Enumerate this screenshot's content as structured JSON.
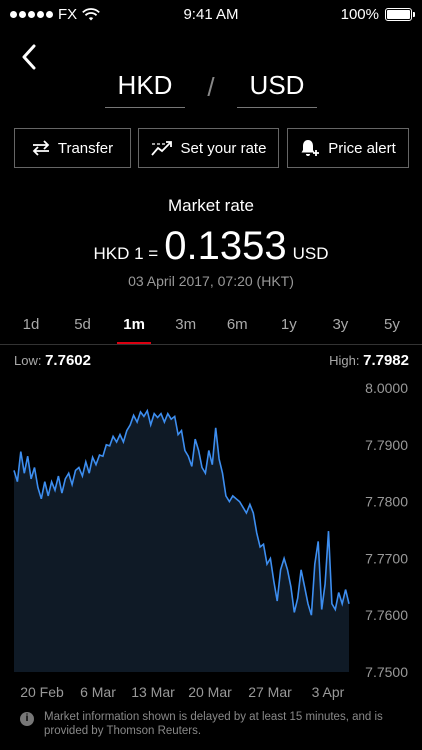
{
  "status_bar": {
    "carrier": "FX",
    "time": "9:41 AM",
    "battery": "100%"
  },
  "pair": {
    "from": "HKD",
    "separator": "/",
    "to": "USD"
  },
  "actions": {
    "transfer": "Transfer",
    "set_rate": "Set your rate",
    "price_alert": "Price alert"
  },
  "market": {
    "label": "Market rate",
    "base": "HKD 1 =",
    "value": "0.1353",
    "quote": "USD",
    "date": "03 April 2017, 07:20 (HKT)"
  },
  "periods": [
    "1d",
    "5d",
    "1m",
    "3m",
    "6m",
    "1y",
    "3y",
    "5y"
  ],
  "active_period": "1m",
  "stats": {
    "low_label": "Low:",
    "low_value": "7.7602",
    "high_label": "High:",
    "high_value": "7.7982"
  },
  "footer": {
    "note": "Market information shown is delayed by at least 15 minutes, and is provided by Thomson Reuters."
  },
  "colors": {
    "accent": "#db0011",
    "line": "#3d8ef0",
    "fill": "#0f1a26"
  },
  "chart_data": {
    "type": "area",
    "ylim": [
      7.75,
      8.0
    ],
    "yticks": [
      "8.0000",
      "7.7900",
      "7.7800",
      "7.7700",
      "7.7600",
      "7.7500"
    ],
    "ytick_values": [
      7.8,
      7.79,
      7.78,
      7.77,
      7.76,
      7.75
    ],
    "xticks": [
      "20 Feb",
      "6 Mar",
      "13 Mar",
      "20 Mar",
      "27 Mar",
      "3 Apr"
    ],
    "values": [
      7.7855,
      7.7835,
      7.7888,
      7.785,
      7.788,
      7.784,
      7.786,
      7.7825,
      7.7805,
      7.7835,
      7.781,
      7.7835,
      7.782,
      7.7845,
      7.7815,
      7.784,
      7.785,
      7.783,
      7.7855,
      7.786,
      7.7845,
      7.787,
      7.785,
      7.7878,
      7.7865,
      7.7882,
      7.788,
      7.79,
      7.7898,
      7.7915,
      7.7905,
      7.7918,
      7.7905,
      7.7925,
      7.7935,
      7.7952,
      7.794,
      7.7958,
      7.795,
      7.796,
      7.7935,
      7.7955,
      7.7948,
      7.7955,
      7.794,
      7.7955,
      7.7945,
      7.795,
      7.7918,
      7.7925,
      7.789,
      7.788,
      7.7862,
      7.791,
      7.789,
      7.786,
      7.785,
      7.789,
      7.7865,
      7.793,
      7.7875,
      7.785,
      7.781,
      7.78,
      7.781,
      7.7805,
      7.78,
      7.779,
      7.778,
      7.7795,
      7.778,
      7.7745,
      7.772,
      7.7725,
      7.769,
      7.77,
      7.766,
      7.7625,
      7.768,
      7.77,
      7.768,
      7.765,
      7.7605,
      7.763,
      7.768,
      7.765,
      7.762,
      7.76,
      7.769,
      7.773,
      7.761,
      7.7655,
      7.7748,
      7.762,
      7.761,
      7.764,
      7.762,
      7.7645,
      7.762
    ]
  }
}
